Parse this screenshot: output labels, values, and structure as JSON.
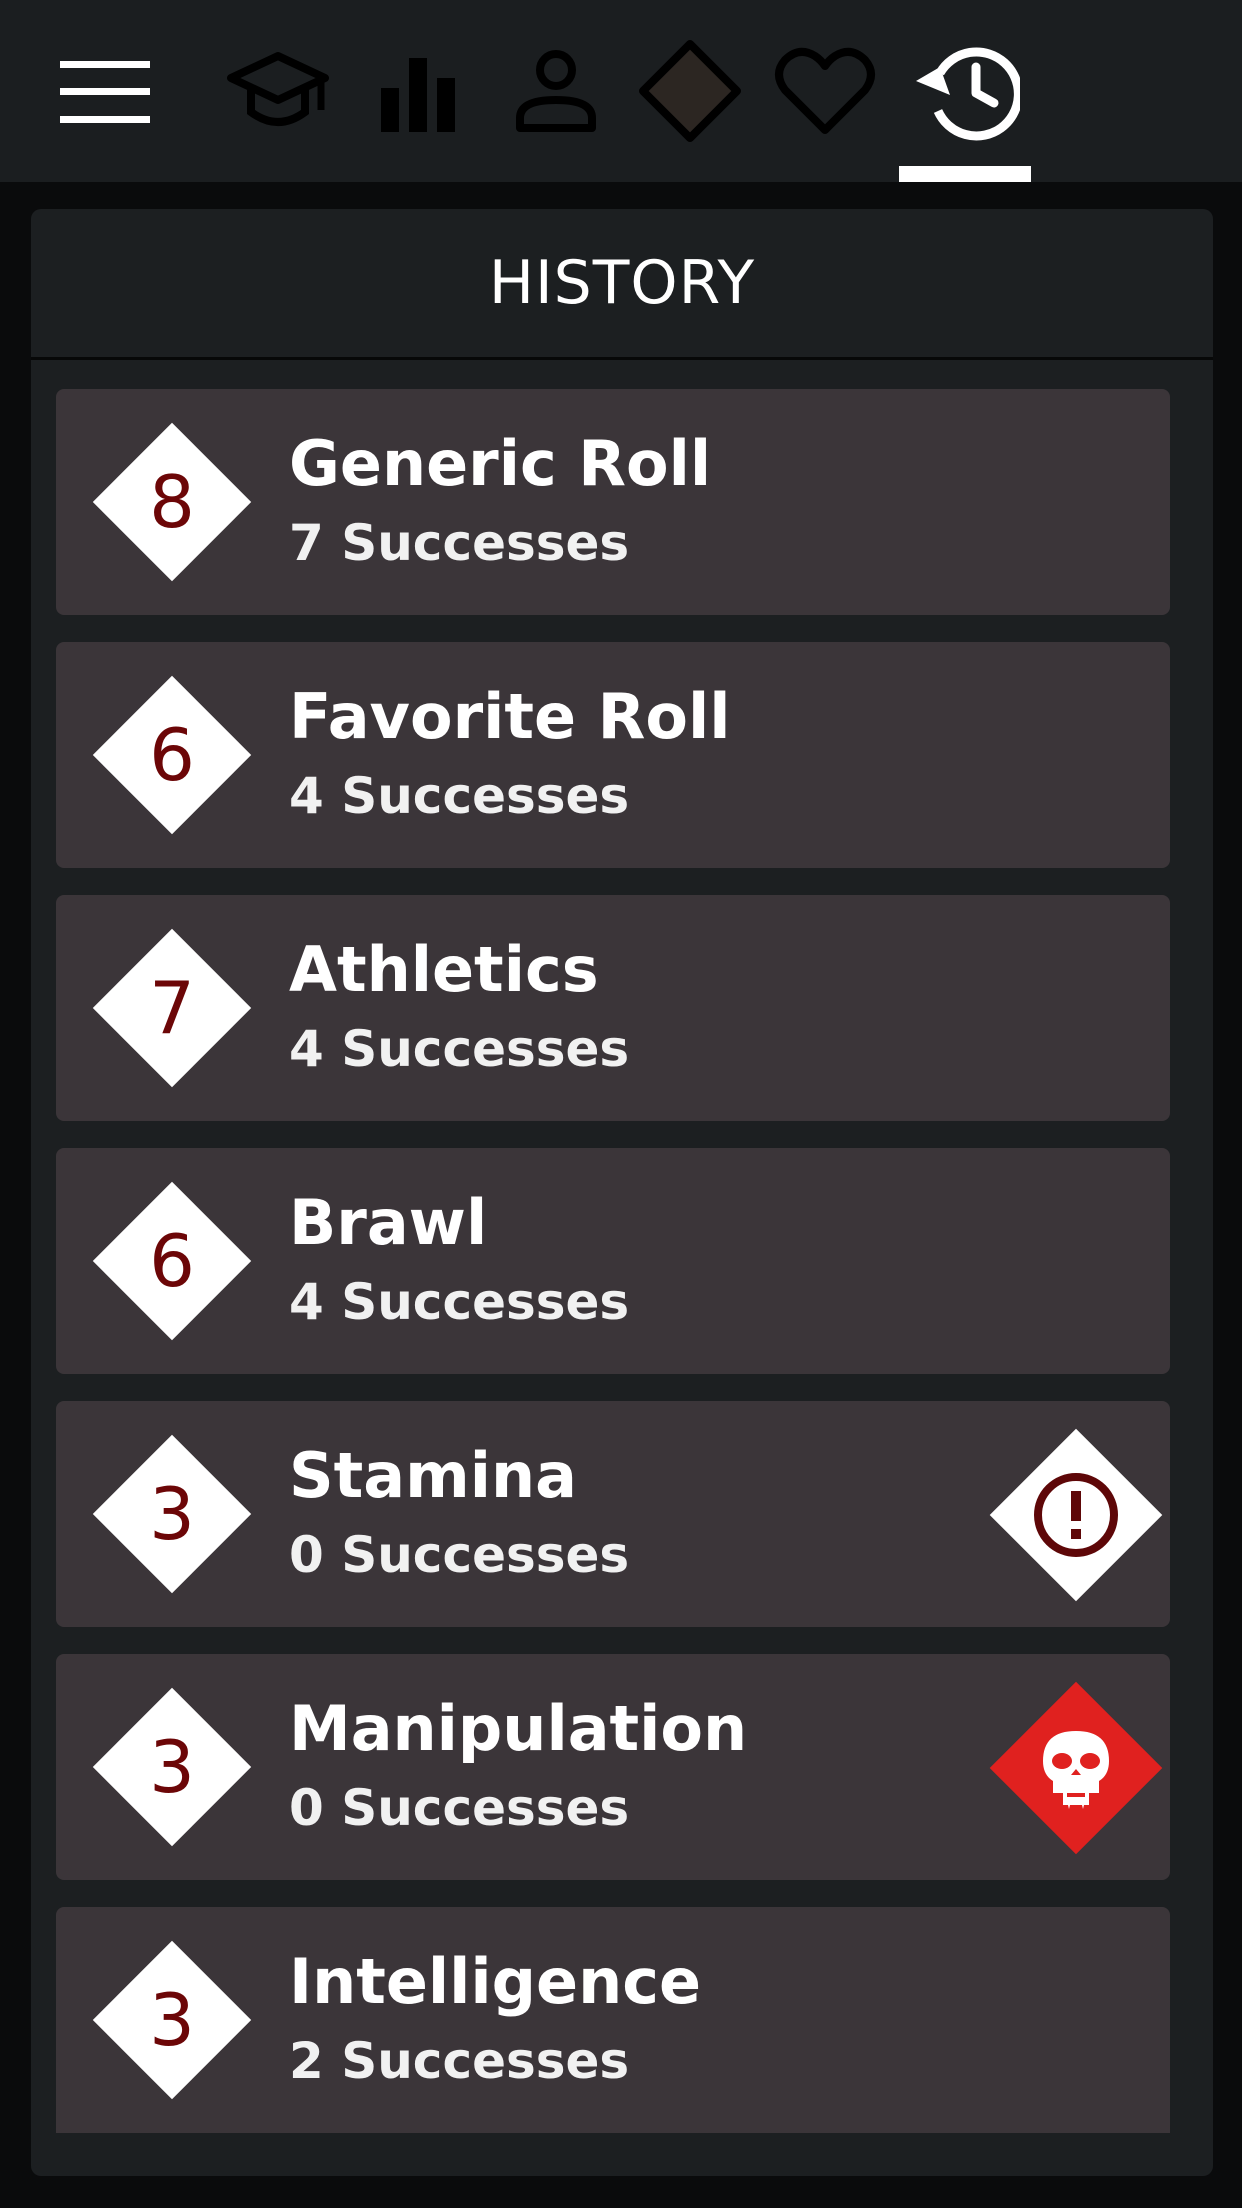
{
  "header": {
    "tabs": [
      {
        "icon": "graduation-cap-icon"
      },
      {
        "icon": "bar-chart-icon"
      },
      {
        "icon": "person-icon"
      },
      {
        "icon": "dice-diamond-icon"
      },
      {
        "icon": "heart-icon"
      },
      {
        "icon": "history-icon",
        "selected": true
      }
    ],
    "menu_icon": "hamburger-menu-icon"
  },
  "panel": {
    "title": "HISTORY"
  },
  "history": [
    {
      "dice": "8",
      "title": "Generic Roll",
      "result": "7 Successes"
    },
    {
      "dice": "6",
      "title": "Favorite Roll",
      "result": "4 Successes"
    },
    {
      "dice": "7",
      "title": "Athletics",
      "result": "4 Successes"
    },
    {
      "dice": "6",
      "title": "Brawl",
      "result": "4 Successes"
    },
    {
      "dice": "3",
      "title": "Stamina",
      "result": "0 Successes",
      "badge": "warning-icon"
    },
    {
      "dice": "3",
      "title": "Manipulation",
      "result": "0 Successes",
      "badge": "vampire-skull-icon"
    },
    {
      "dice": "3",
      "title": "Intelligence",
      "result": "2 Successes"
    }
  ],
  "colors": {
    "topbar": "#1b1e20",
    "panel": "#1c1f21",
    "card": "#3b3539",
    "dice_number": "#6c0607",
    "bestial_badge": "#e0211f"
  }
}
